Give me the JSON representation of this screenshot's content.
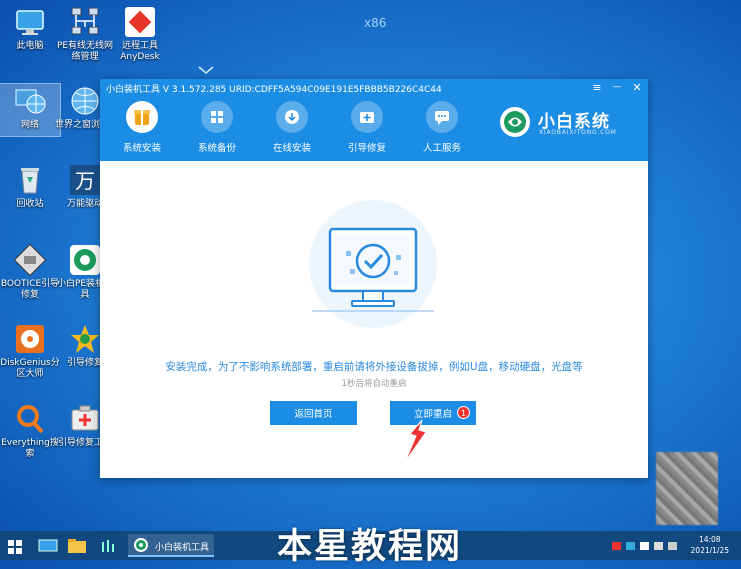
{
  "desktop": {
    "watermark_top": "x86",
    "icons": [
      {
        "label": "此电脑",
        "icon": "computer-icon"
      },
      {
        "label": "PE有线无线网络管理",
        "icon": "network-manager-icon"
      },
      {
        "label": "远程工具AnyDesk",
        "icon": "anydesk-icon"
      },
      {
        "label": "网络",
        "icon": "network-globe-icon"
      },
      {
        "label": "世界之窗浏览器",
        "icon": "browser-globe-icon"
      },
      {
        "label": "回收站",
        "icon": "recycle-bin-icon"
      },
      {
        "label": "万能驱动",
        "icon": "driver-icon"
      },
      {
        "label": "BOOTICE引导修复",
        "icon": "bootice-icon"
      },
      {
        "label": "小白PE装机工具",
        "icon": "xiaobai-pe-icon"
      },
      {
        "label": "DiskGenius分区大师",
        "icon": "diskgenius-icon"
      },
      {
        "label": "引导修复",
        "icon": "boot-repair-icon"
      },
      {
        "label": "Everything搜索",
        "icon": "everything-search-icon"
      },
      {
        "label": "引导修复工具",
        "icon": "boot-repair-tool-icon"
      }
    ]
  },
  "window": {
    "title": "小白装机工具 V 3.1.572.285 URID:CDFF5A594C09E191E5FBBB5B226C4C44",
    "controls": {
      "menu": "≡",
      "minimize": "—",
      "close": "✕"
    },
    "nav": [
      {
        "label": "系统安装",
        "active": true
      },
      {
        "label": "系统备份",
        "active": false
      },
      {
        "label": "在线安装",
        "active": false
      },
      {
        "label": "引导修复",
        "active": false
      },
      {
        "label": "人工服务",
        "active": false
      }
    ],
    "brand": {
      "name": "小白系统",
      "sub": "XIAOBAIXITONG.COM"
    },
    "message": "安装完成，为了不影响系统部署，重启前请将外接设备拔掉，例如U盘，移动硬盘，光盘等",
    "submessage": "1秒后将自动重启",
    "back_button": "返回首页",
    "restart_button": "立即重启",
    "badge": "1"
  },
  "taskbar": {
    "task_label": "小白装机工具",
    "time": "14:08",
    "date": "2021/1/25"
  },
  "overlay_watermark": "本星教程网",
  "colors": {
    "primary": "#1c8de4",
    "taskbar": "#10487f",
    "badge": "#e33333"
  }
}
